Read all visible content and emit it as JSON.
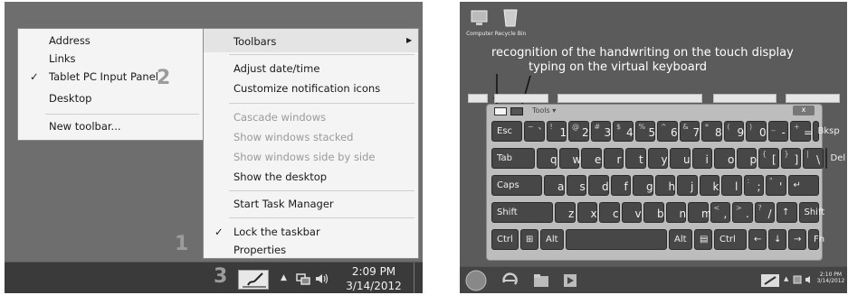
{
  "left_screenshot": {
    "toolbars_submenu": {
      "items": [
        {
          "label": "Address",
          "checked": false
        },
        {
          "label": "Links",
          "checked": false
        },
        {
          "label": "Tablet PC Input Panel",
          "checked": true
        },
        {
          "label": "Desktop",
          "checked": false
        },
        {
          "label": "New toolbar...",
          "checked": false
        }
      ],
      "check_glyph": "✓"
    },
    "context_menu": {
      "toolbars": "Toolbars",
      "adjust_datetime": "Adjust date/time",
      "customize_icons": "Customize notification icons",
      "cascade": "Cascade windows",
      "stacked": "Show windows stacked",
      "side_by_side": "Show windows side by side",
      "show_desktop": "Show the desktop",
      "task_manager": "Start Task Manager",
      "lock_taskbar": "Lock the taskbar",
      "properties": "Properties",
      "check_glyph": "✓",
      "arrow_glyph": "▶"
    },
    "callouts": {
      "one": "1",
      "two": "2",
      "three": "3"
    },
    "clock": {
      "time": "2:09 PM",
      "date": "3/14/2012"
    }
  },
  "right_screenshot": {
    "desktop_icons": {
      "computer": "Computer",
      "recycle_bin": "Recycle Bin"
    },
    "annotations": {
      "line1": "recognition of the handwriting on the touch display",
      "line2": "typing on the virtual keyboard"
    },
    "keyboard": {
      "tools_label": "Tools ▾",
      "close_glyph": "x",
      "row1": [
        {
          "shift": "~",
          "main": "`"
        },
        {
          "shift": "!",
          "main": "1"
        },
        {
          "shift": "@",
          "main": "2"
        },
        {
          "shift": "#",
          "main": "3"
        },
        {
          "shift": "$",
          "main": "4"
        },
        {
          "shift": "%",
          "main": "5"
        },
        {
          "shift": "^",
          "main": "6"
        },
        {
          "shift": "&",
          "main": "7"
        },
        {
          "shift": "*",
          "main": "8"
        },
        {
          "shift": "(",
          "main": "9"
        },
        {
          "shift": ")",
          "main": "0"
        },
        {
          "shift": "_",
          "main": "-"
        },
        {
          "shift": "+",
          "main": "="
        }
      ],
      "row2": [
        "q",
        "w",
        "e",
        "r",
        "t",
        "y",
        "u",
        "i",
        "o",
        "p"
      ],
      "row2_extra": [
        {
          "shift": "{",
          "main": "["
        },
        {
          "shift": "}",
          "main": "]"
        },
        {
          "shift": "|",
          "main": "\\"
        }
      ],
      "row3": [
        "a",
        "s",
        "d",
        "f",
        "g",
        "h",
        "j",
        "k",
        "l"
      ],
      "row3_extra": [
        {
          "shift": ":",
          "main": ";"
        },
        {
          "shift": "\"",
          "main": "'"
        }
      ],
      "row4": [
        "z",
        "x",
        "c",
        "v",
        "b",
        "n",
        "m"
      ],
      "row4_extra": [
        {
          "shift": "<",
          "main": ","
        },
        {
          "shift": ">",
          "main": "."
        },
        {
          "shift": "?",
          "main": "/"
        }
      ],
      "labels": {
        "esc": "Esc",
        "bksp": "Bksp",
        "tab": "Tab",
        "del": "Del",
        "caps": "Caps",
        "enter": "↵",
        "shift": "Shift",
        "shift_right": "Shift",
        "up": "↑",
        "ctrl": "Ctrl",
        "win": "⊞",
        "alt": "Alt",
        "alt_right": "Alt",
        "menu": "▤",
        "ctrl_right": "Ctrl",
        "left": "←",
        "down": "↓",
        "right": "→",
        "fn": "Fn"
      }
    },
    "clock": {
      "time": "2:10 PM",
      "date": "3/14/2012"
    }
  }
}
